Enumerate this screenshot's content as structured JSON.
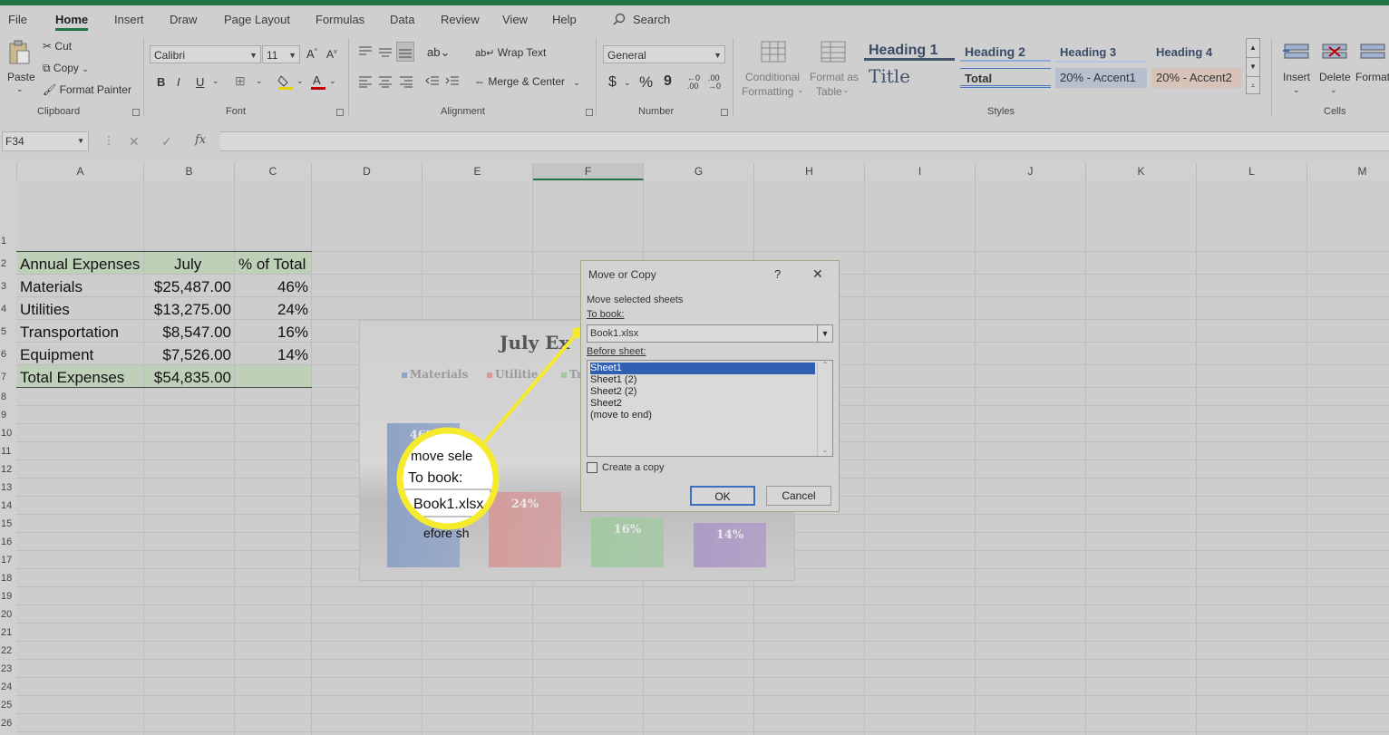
{
  "menu_tabs": [
    "File",
    "Home",
    "Insert",
    "Draw",
    "Page Layout",
    "Formulas",
    "Data",
    "Review",
    "View",
    "Help"
  ],
  "search": {
    "label": "Search"
  },
  "ribbon": {
    "clipboard": {
      "paste": "Paste",
      "cut": "Cut",
      "copy": "Copy",
      "format_painter": "Format Painter",
      "group": "Clipboard"
    },
    "font": {
      "name": "Calibri",
      "size": "11",
      "bold": "B",
      "italic": "I",
      "underline": "U",
      "group": "Font"
    },
    "alignment": {
      "wrap_text": "Wrap Text",
      "merge_center": "Merge & Center",
      "group": "Alignment"
    },
    "number": {
      "format": "General",
      "currency": "$",
      "percent": "%",
      "comma": "9",
      "group": "Number"
    },
    "styles": {
      "conditional_1": "Conditional",
      "conditional_2": "Formatting",
      "format_as_1": "Format as",
      "format_as_2": "Table",
      "heading1": "Heading 1",
      "heading2": "Heading 2",
      "heading3": "Heading 3",
      "heading4": "Heading 4",
      "title": "Title",
      "total": "Total",
      "accent1": "20% - Accent1",
      "accent2": "20% - Accent2",
      "group": "Styles"
    },
    "cells": {
      "insert": "Insert",
      "delete": "Delete",
      "format": "Format",
      "group": "Cells"
    }
  },
  "formula_bar": {
    "name_box": "F34",
    "fx": "fx",
    "cancel": "✕",
    "enter": "✓"
  },
  "columns": [
    "A",
    "B",
    "C",
    "D",
    "E",
    "F",
    "G",
    "H",
    "I",
    "J",
    "K",
    "L",
    "M"
  ],
  "rows": [
    "1",
    "2",
    "3",
    "4",
    "5",
    "6",
    "7",
    "8",
    "9",
    "10",
    "11",
    "12",
    "13",
    "14",
    "15",
    "16",
    "17",
    "18",
    "19",
    "20",
    "21",
    "22",
    "23",
    "24",
    "25",
    "26"
  ],
  "table": {
    "header": [
      "Annual Expenses",
      "July",
      "% of Total"
    ],
    "rows": [
      [
        "Materials",
        "$25,487.00",
        "46%"
      ],
      [
        "Utilities",
        "$13,275.00",
        "24%"
      ],
      [
        "Transportation",
        "$8,547.00",
        "16%"
      ],
      [
        "Equipment",
        "$7,526.00",
        "14%"
      ]
    ],
    "total": [
      "Total Expenses",
      "$54,835.00"
    ]
  },
  "chart": {
    "title_visible": "July Ex",
    "legend": [
      "Materials",
      "Utilitie",
      "Tr"
    ],
    "bar_labels": [
      "46%",
      "24%",
      "16%",
      "14%"
    ],
    "colors": [
      "#8fa3c6",
      "#d49c9c",
      "#a3c9a3",
      "#ae9bc6"
    ]
  },
  "chart_data": {
    "type": "bar",
    "categories": [
      "Materials",
      "Utilities",
      "Transportation",
      "Equipment"
    ],
    "values": [
      46,
      24,
      16,
      14
    ],
    "title": "July Ex",
    "xlabel": "",
    "ylabel": "",
    "ylim": [
      0,
      50
    ]
  },
  "dialog": {
    "title": "Move or Copy",
    "help": "?",
    "close": "✕",
    "move_label": "Move selected sheets",
    "to_book_label": "To book:",
    "to_book_value": "Book1.xlsx",
    "before_sheet_label": "Before sheet:",
    "sheets": [
      "Sheet1",
      "Sheet1 (2)",
      "Sheet2 (2)",
      "Sheet2",
      "(move to end)"
    ],
    "selected_index": 0,
    "create_copy": "Create a copy",
    "ok": "OK",
    "cancel": "Cancel"
  },
  "magnifier": {
    "line1": "move sele",
    "line2": "To book:",
    "value": "Book1.xlsx",
    "line3": "efore sh",
    "highlight_color": "#f6ea2e"
  }
}
